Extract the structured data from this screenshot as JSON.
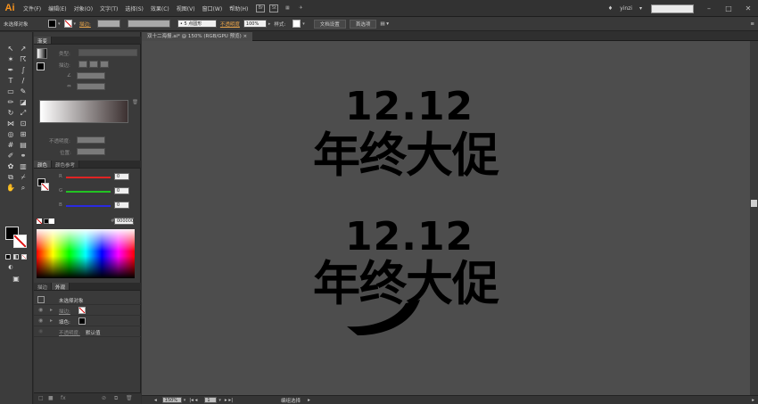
{
  "app": {
    "logo": "Ai"
  },
  "menu": [
    "文件(F)",
    "编辑(E)",
    "对象(O)",
    "文字(T)",
    "选择(S)",
    "效果(C)",
    "视图(V)",
    "窗口(W)",
    "帮助(H)"
  ],
  "menu_icons": [
    "Br",
    "St"
  ],
  "topbar": {
    "user": "yinzi",
    "search_placeholder": ""
  },
  "control": {
    "selection": "未选择对象",
    "stroke_label": "描边:",
    "brush_value": "5 点圆形",
    "opacity_label": "不透明度",
    "opacity_value": "100%",
    "style_label": "样式:",
    "doc_setup": "文档设置",
    "preferences": "首选项"
  },
  "gradient_panel": {
    "tab": "渐变",
    "type_label": "类型:",
    "stroke_label": "描边:",
    "opacity_label": "不透明度:",
    "position_label": "位置:"
  },
  "color_panel": {
    "tabs": [
      "颜色",
      "颜色参考"
    ],
    "channels": [
      {
        "name": "R",
        "value": "0",
        "color": "#e02424"
      },
      {
        "name": "G",
        "value": "0",
        "color": "#22c322"
      },
      {
        "name": "B",
        "value": "0",
        "color": "#2a2ae0"
      }
    ],
    "hex_label": "#",
    "hex": "000000"
  },
  "appearance_panel": {
    "tabs": [
      "描边",
      "外观"
    ],
    "title": "未选择对象",
    "stroke_label": "描边:",
    "fill_label": "填色:",
    "opacity_label": "不透明度:",
    "opacity_value": "默认值"
  },
  "document": {
    "tab_label": "双十二海报.ai* @ 150% (RGB/GPU 预览)",
    "zoom": "150%",
    "page": "1",
    "status": "编组选择"
  },
  "artwork": [
    {
      "date": "12.12",
      "slogan": "年终大促"
    },
    {
      "date": "12.12",
      "slogan": "年终大促"
    }
  ]
}
